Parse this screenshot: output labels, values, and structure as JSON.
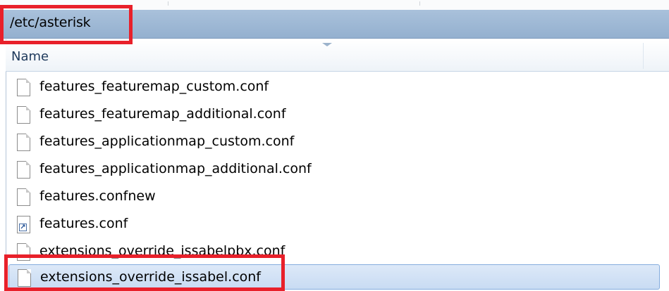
{
  "path": "/etc/asterisk",
  "columns": {
    "name": "Name"
  },
  "files": [
    {
      "name": "features_featuremap_custom.conf",
      "icon": "file-icon"
    },
    {
      "name": "features_featuremap_additional.conf",
      "icon": "file-icon"
    },
    {
      "name": "features_applicationmap_custom.conf",
      "icon": "file-icon"
    },
    {
      "name": "features_applicationmap_additional.conf",
      "icon": "file-icon"
    },
    {
      "name": "features.confnew",
      "icon": "file-icon"
    },
    {
      "name": "features.conf",
      "icon": "shortcut-file-icon"
    },
    {
      "name": "extensions_override_issabelpbx.conf",
      "icon": "file-icon"
    },
    {
      "name": "extensions_override_issabel.conf",
      "icon": "file-icon",
      "selected": true
    }
  ],
  "colors": {
    "path_bar": "#a9c1db",
    "selection": "#cfe0f5",
    "highlight": "#e8202a"
  }
}
